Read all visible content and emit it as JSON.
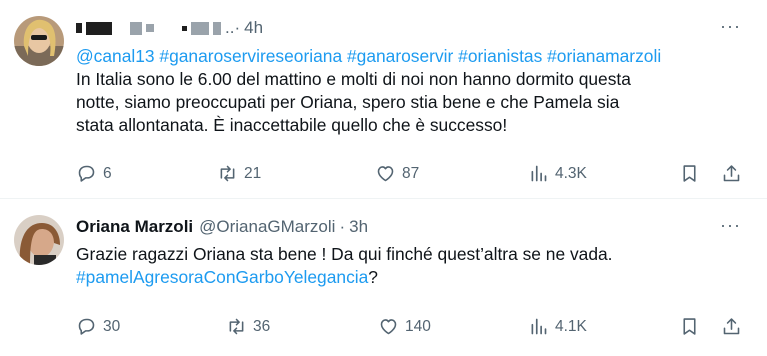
{
  "tweets": [
    {
      "avatar_icon": "profile-photo",
      "name_redacted": true,
      "handle_redacted": true,
      "time": "4h",
      "more_label": "···",
      "mentions_line": [
        "@canal13",
        "#ganaroservireseoriana",
        "#ganaroservir",
        "#orianistas",
        "#orianamarzoli"
      ],
      "text": "In Italia sono le 6.00 del mattino e molti di noi non hanno dormito questa notte, siamo preoccupati per Oriana, spero stia bene e che Pamela sia stata allontanata. È inaccettabile quello che è successo!",
      "stats": {
        "replies": "6",
        "reposts": "21",
        "likes": "87",
        "views": "4.3K"
      }
    },
    {
      "avatar_icon": "profile-photo",
      "name": "Oriana Marzoli",
      "handle": "@OrianaGMarzoli",
      "sep": "·",
      "time": "3h",
      "more_label": "···",
      "text": "Grazie ragazzi Oriana sta bene ! Da qui finché quest’altra se ne vada.",
      "hashtag": "#pamelAgresoraConGarboYelegancia",
      "hashtag_suffix": "?",
      "stats": {
        "replies": "30",
        "reposts": "36",
        "likes": "140",
        "views": "4.1K"
      }
    }
  ],
  "colors": {
    "link": "#1d9bf0",
    "muted": "#536471",
    "text": "#0f1419"
  }
}
